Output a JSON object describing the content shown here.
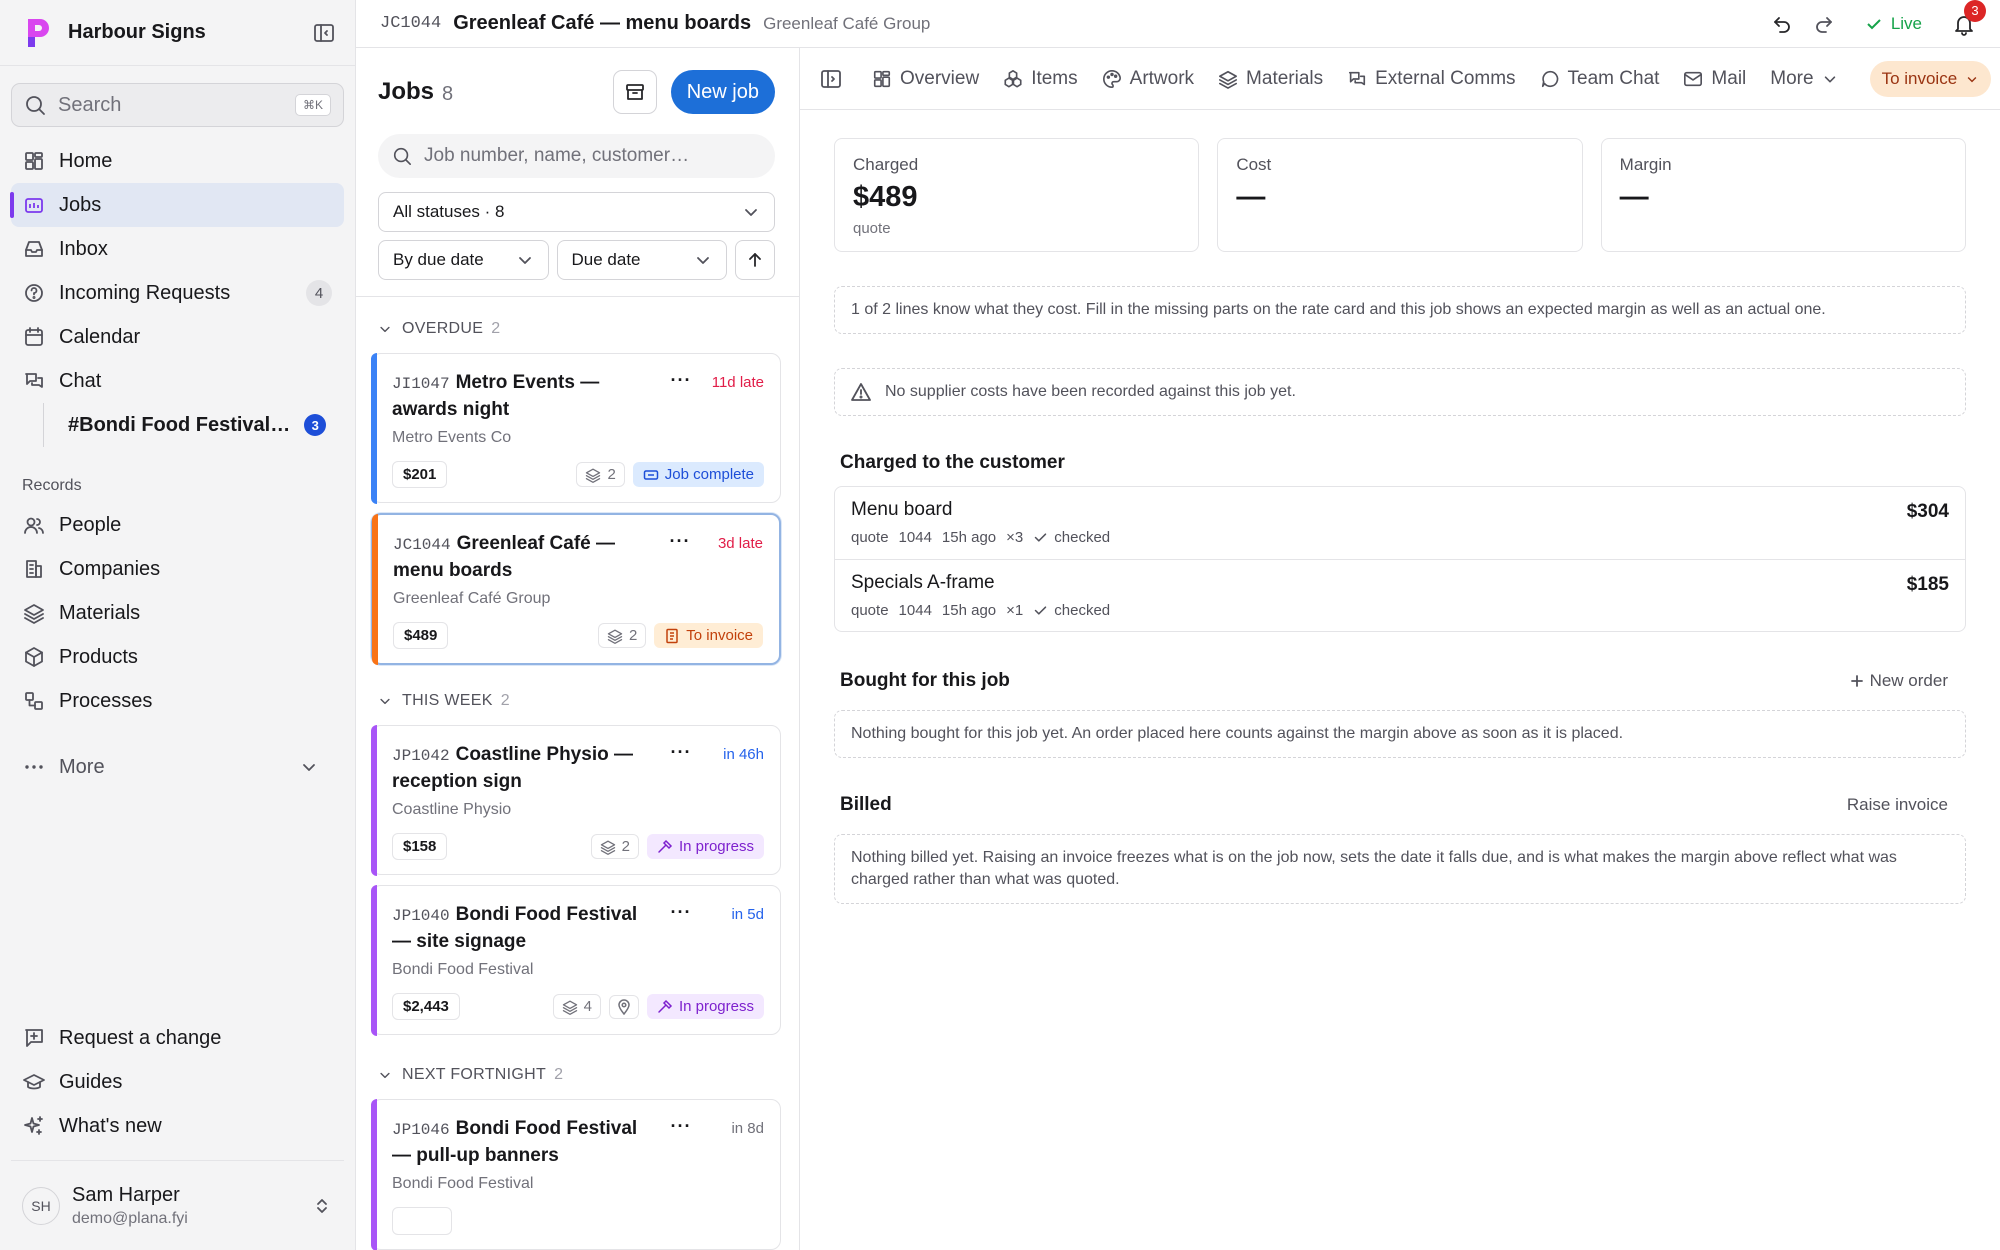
{
  "brand": {
    "name": "Harbour Signs",
    "logo_color": "#d946ef"
  },
  "sidebar": {
    "search_placeholder": "Search",
    "search_shortcut": "⌘K",
    "nav": [
      {
        "label": "Home",
        "icon": "grid-icon"
      },
      {
        "label": "Jobs",
        "icon": "jobs-icon",
        "active": true
      },
      {
        "label": "Inbox",
        "icon": "inbox-icon"
      },
      {
        "label": "Incoming Requests",
        "icon": "question-icon",
        "count": "4"
      },
      {
        "label": "Calendar",
        "icon": "calendar-icon"
      },
      {
        "label": "Chat",
        "icon": "chat-icon"
      }
    ],
    "chat_channel": {
      "label": "#Bondi Food Festival…",
      "badge": "3"
    },
    "records_label": "Records",
    "records": [
      {
        "label": "People",
        "icon": "people-icon"
      },
      {
        "label": "Companies",
        "icon": "building-icon"
      },
      {
        "label": "Materials",
        "icon": "layers-icon"
      },
      {
        "label": "Products",
        "icon": "box-icon"
      },
      {
        "label": "Processes",
        "icon": "process-icon"
      }
    ],
    "more_label": "More",
    "bottom": [
      {
        "label": "Request a change",
        "icon": "request-icon"
      },
      {
        "label": "Guides",
        "icon": "guides-icon"
      },
      {
        "label": "What's new",
        "icon": "sparkle-icon"
      }
    ],
    "user": {
      "initials": "SH",
      "name": "Sam Harper",
      "email": "demo@plana.fyi"
    }
  },
  "topbar": {
    "code": "JC1044",
    "title": "Greenleaf Café — menu boards",
    "subtitle": "Greenleaf Café Group",
    "live_label": "Live",
    "notifications": "3"
  },
  "jobs": {
    "title": "Jobs",
    "count": "8",
    "new_job_label": "New job",
    "search_placeholder": "Job number, name, customer…",
    "status_filter": "All statuses · 8",
    "group_by": "By due date",
    "sort_field": "Due date",
    "groups": [
      {
        "title": "OVERDUE",
        "count": "2",
        "cards": [
          {
            "code": "JI1047",
            "title": "Metro Events — awards night",
            "customer": "Metro Events Co",
            "due": "11d late",
            "price": "$201",
            "layers": "2",
            "status": "Job complete"
          },
          {
            "code": "JC1044",
            "title": "Greenleaf Café — menu boards",
            "customer": "Greenleaf Café Group",
            "due": "3d late",
            "price": "$489",
            "layers": "2",
            "status": "To invoice"
          }
        ]
      },
      {
        "title": "THIS WEEK",
        "count": "2",
        "cards": [
          {
            "code": "JP1042",
            "title": "Coastline Physio — reception sign",
            "customer": "Coastline Physio",
            "due": "in 46h",
            "price": "$158",
            "layers": "2",
            "status": "In progress"
          },
          {
            "code": "JP1040",
            "title": "Bondi Food Festival — site signage",
            "customer": "Bondi Food Festival",
            "due": "in 5d",
            "price": "$2,443",
            "layers": "4",
            "status": "In progress"
          }
        ]
      },
      {
        "title": "NEXT FORTNIGHT",
        "count": "2",
        "cards": [
          {
            "code": "JP1046",
            "title": "Bondi Food Festival — pull-up banners",
            "customer": "Bondi Food Festival",
            "due": "in 8d"
          }
        ]
      }
    ]
  },
  "detail": {
    "tabs": [
      {
        "label": "Overview",
        "icon": "grid-icon"
      },
      {
        "label": "Items",
        "icon": "items-icon"
      },
      {
        "label": "Artwork",
        "icon": "palette-icon"
      },
      {
        "label": "Materials",
        "icon": "layers-icon"
      },
      {
        "label": "External Comms",
        "icon": "comms-icon"
      },
      {
        "label": "Team Chat",
        "icon": "chat-bubble-icon"
      },
      {
        "label": "Mail",
        "icon": "mail-icon"
      },
      {
        "label": "More",
        "icon": "chevron-down-icon"
      }
    ],
    "status_pill": "To invoice",
    "stats": [
      {
        "label": "Charged",
        "value": "$489",
        "sub": "quote"
      },
      {
        "label": "Cost",
        "value": "—",
        "sub": ""
      },
      {
        "label": "Margin",
        "value": "—",
        "sub": ""
      }
    ],
    "cost_note": "1 of 2 lines know what they cost. Fill in the missing parts on the rate card and this job shows an expected margin as well as an actual one.",
    "supplier_note": "No supplier costs have been recorded against this job yet.",
    "charged_title": "Charged to the customer",
    "charged_lines": [
      {
        "name": "Menu board",
        "source": "quote",
        "ref": "1044",
        "age": "15h ago",
        "qty": "×3",
        "check": "checked",
        "price": "$304"
      },
      {
        "name": "Specials A-frame",
        "source": "quote",
        "ref": "1044",
        "age": "15h ago",
        "qty": "×1",
        "check": "checked",
        "price": "$185"
      }
    ],
    "bought_title": "Bought for this job",
    "new_order_label": "New order",
    "bought_note": "Nothing bought for this job yet. An order placed here counts against the margin above as soon as it is placed.",
    "billed_title": "Billed",
    "raise_invoice_label": "Raise invoice",
    "billed_note": "Nothing billed yet. Raising an invoice freezes what is on the job now, sets the date it falls due, and is what makes the margin above reflect what was charged rather than what was quoted."
  }
}
